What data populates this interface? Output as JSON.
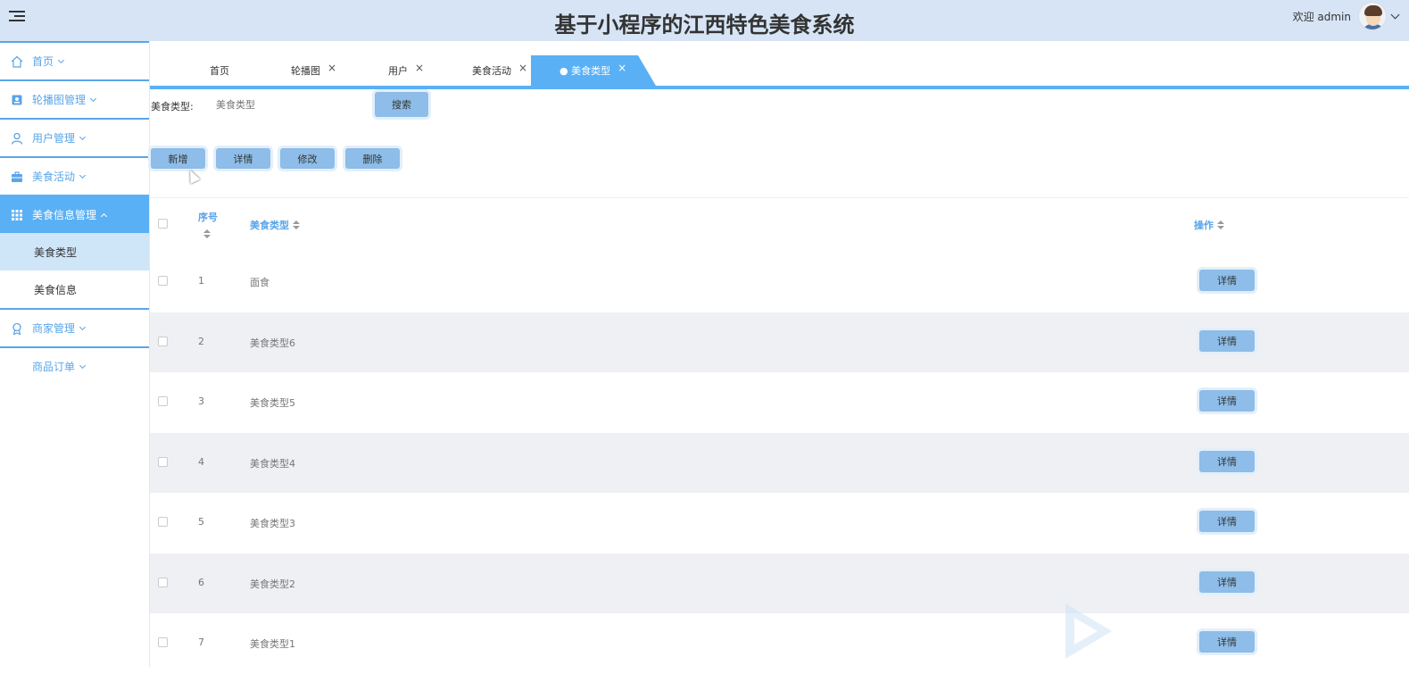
{
  "header": {
    "title": "基于小程序的江西特色美食系统",
    "welcome": "欢迎 admin"
  },
  "sidebar": {
    "items": [
      {
        "label": "首页",
        "icon": "home-icon"
      },
      {
        "label": "轮播图管理",
        "icon": "carousel-icon"
      },
      {
        "label": "用户管理",
        "icon": "user-icon"
      },
      {
        "label": "美食活动",
        "icon": "briefcase-icon"
      },
      {
        "label": "美食信息管理",
        "icon": "grid-icon"
      },
      {
        "label": "商家管理",
        "icon": "badge-icon"
      },
      {
        "label": "商品订单",
        "icon": ""
      }
    ],
    "subitems": [
      {
        "label": "美食类型"
      },
      {
        "label": "美食信息"
      }
    ]
  },
  "tabs": [
    {
      "label": "首页"
    },
    {
      "label": "轮播图",
      "close": "×"
    },
    {
      "label": "用户",
      "close": "×"
    },
    {
      "label": "美食活动",
      "close": "×"
    },
    {
      "label": "● 美食类型",
      "close": "×"
    }
  ],
  "search": {
    "label": "美食类型:",
    "placeholder": "美食类型",
    "button": "搜索"
  },
  "actions": {
    "add": "新增",
    "detail": "详情",
    "edit": "修改",
    "delete": "删除"
  },
  "table": {
    "columns": {
      "index": "序号",
      "type": "美食类型",
      "ops": "操作"
    },
    "rows": [
      {
        "index": "1",
        "name": "面食",
        "action": "详情"
      },
      {
        "index": "2",
        "name": "美食类型6",
        "action": "详情"
      },
      {
        "index": "3",
        "name": "美食类型5",
        "action": "详情"
      },
      {
        "index": "4",
        "name": "美食类型4",
        "action": "详情"
      },
      {
        "index": "5",
        "name": "美食类型3",
        "action": "详情"
      },
      {
        "index": "6",
        "name": "美食类型2",
        "action": "详情"
      },
      {
        "index": "7",
        "name": "美食类型1",
        "action": "详情"
      }
    ]
  },
  "colors": {
    "accent": "#5ab0f5",
    "button": "#8dbde8",
    "header_bg": "#d6e4f5",
    "row_alt": "#eef0f3"
  }
}
